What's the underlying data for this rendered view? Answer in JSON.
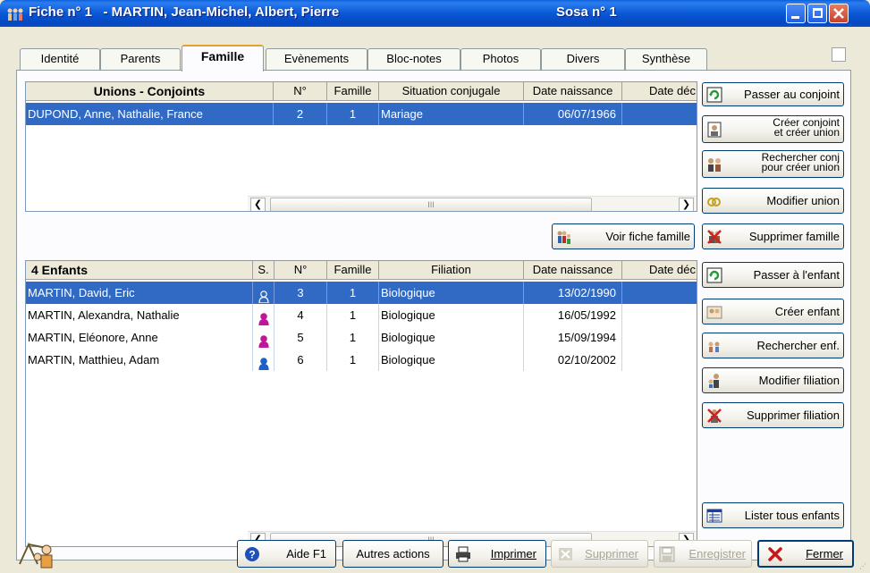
{
  "window": {
    "title": "Fiche n° 1   - MARTIN, Jean-Michel, Albert, Pierre",
    "sosa": "Sosa n° 1"
  },
  "tabs": [
    "Identité",
    "Parents",
    "Famille",
    "Evènements",
    "Bloc-notes",
    "Photos",
    "Divers",
    "Synthèse"
  ],
  "unions": {
    "headers": [
      "Unions - Conjoints",
      "N°",
      "Famille",
      "Situation conjugale",
      "Date naissance",
      "Date déc"
    ],
    "rows": [
      {
        "name": "DUPOND, Anne, Nathalie, France",
        "num": "2",
        "famille": "1",
        "situation": "Mariage",
        "naissance": "06/07/1966",
        "deces": ""
      }
    ]
  },
  "enfants": {
    "headers": [
      "4 Enfants",
      "S.",
      "N°",
      "Famille",
      "Filiation",
      "Date naissance",
      "Date déc"
    ],
    "rows": [
      {
        "name": "MARTIN, David, Eric",
        "sex": "M",
        "num": "3",
        "famille": "1",
        "filiation": "Biologique",
        "naissance": "13/02/1990",
        "deces": ""
      },
      {
        "name": "MARTIN, Alexandra, Nathalie",
        "sex": "F",
        "num": "4",
        "famille": "1",
        "filiation": "Biologique",
        "naissance": "16/05/1992",
        "deces": ""
      },
      {
        "name": "MARTIN, Eléonore, Anne",
        "sex": "F",
        "num": "5",
        "famille": "1",
        "filiation": "Biologique",
        "naissance": "15/09/1994",
        "deces": ""
      },
      {
        "name": "MARTIN, Matthieu, Adam",
        "sex": "M",
        "num": "6",
        "famille": "1",
        "filiation": "Biologique",
        "naissance": "02/10/2002",
        "deces": ""
      }
    ]
  },
  "scroll_thumb": "III",
  "side_buttons": {
    "passer_conjoint": "Passer au conjoint",
    "creer_conjoint_1": "Créer conjoint",
    "creer_conjoint_2": "et créer union",
    "rechercher_conj_1": "Rechercher conj",
    "rechercher_conj_2": "pour créer union",
    "modifier_union": "Modifier union",
    "supprimer_famille": "Supprimer famille",
    "voir_fiche_famille": "Voir fiche famille",
    "passer_enfant": "Passer à l'enfant",
    "creer_enfant": "Créer enfant",
    "rechercher_enf": "Rechercher enf.",
    "modifier_filiation": "Modifier filiation",
    "supprimer_filiation": "Supprimer filiation",
    "lister_enfants": "Lister tous enfants"
  },
  "footer": {
    "aide": "Aide   F1",
    "autres_actions": "Autres actions",
    "imprimer": "Imprimer",
    "supprimer": "Supprimer",
    "enregistrer": "Enregistrer",
    "fermer": "Fermer"
  },
  "colors": {
    "selection": "#316AC5",
    "male": "#1F5FC8",
    "female": "#C0169A"
  }
}
